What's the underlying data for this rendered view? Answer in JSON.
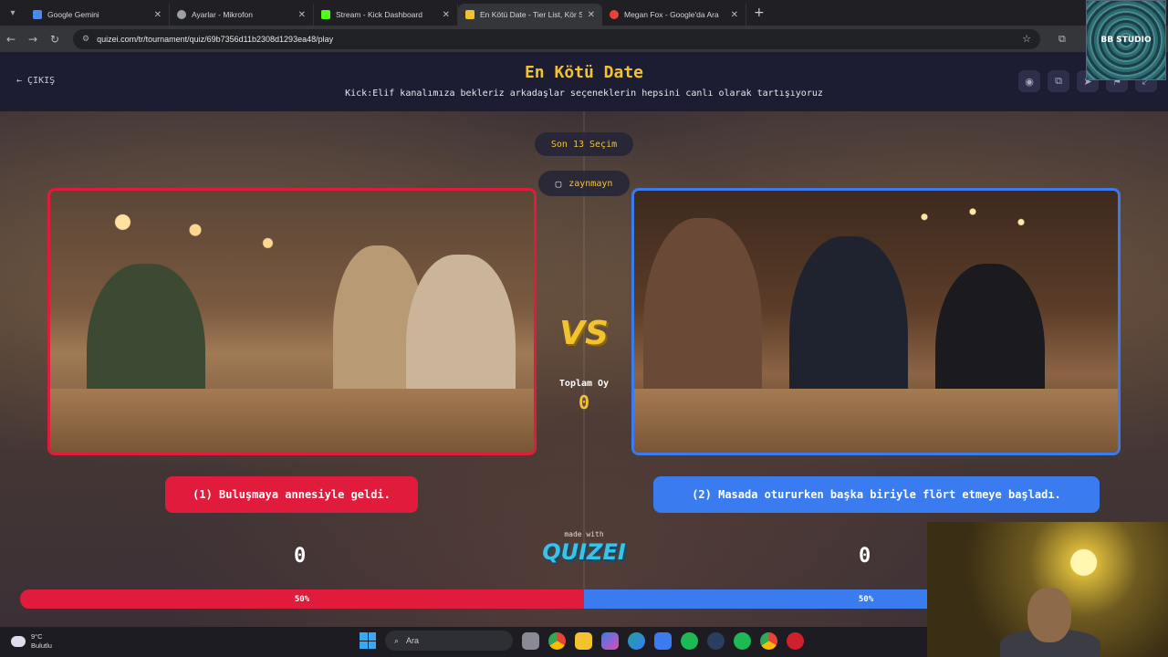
{
  "browser": {
    "tabs": [
      {
        "title": "Google Gemini",
        "color": "#4a8af0",
        "active": false
      },
      {
        "title": "Ayarlar - Mikrofon",
        "color": "#9aa0a6",
        "active": false
      },
      {
        "title": "Stream - Kick Dashboard",
        "color": "#53fc18",
        "active": false
      },
      {
        "title": "En Kötü Date - Tier List, Kör Sır",
        "color": "#f2c230",
        "active": true
      },
      {
        "title": "Megan Fox - Google'da Ara",
        "color": "#ea4335",
        "active": false
      }
    ],
    "url": "quizei.com/tr/tournament/quiz/69b7356d11b2308d1293ea48/play"
  },
  "overlay": {
    "bb_label": "BB STUDIO"
  },
  "header": {
    "exit_label": "ÇIKIŞ",
    "title": "En Kötü Date",
    "subtitle": "Kick:Elif kanalımıza bekleriz arkadaşlar seçeneklerin hepsini canlı olarak tartışıyoruz"
  },
  "round": {
    "label": "Son 13 Seçim",
    "user": "zaynmayn"
  },
  "vs": {
    "label": "VS",
    "total_label": "Toplam Oy",
    "total_value": "0"
  },
  "choices": {
    "left": {
      "label": "(1) Buluşmaya annesiyle geldi.",
      "score": "0",
      "percent_label": "50%",
      "share": 0.5,
      "color": "#e01b3c"
    },
    "right": {
      "label": "(2) Masada otururken başka biriyle flört etmeye başladı.",
      "score": "0",
      "percent_label": "50%",
      "share": 0.5,
      "color": "#3a7cf0"
    }
  },
  "branding": {
    "made_with": "made with",
    "logo": "QUIZEI"
  },
  "taskbar": {
    "weather_temp": "9°C",
    "weather_desc": "Bulutlu",
    "search_label": "Ara"
  }
}
